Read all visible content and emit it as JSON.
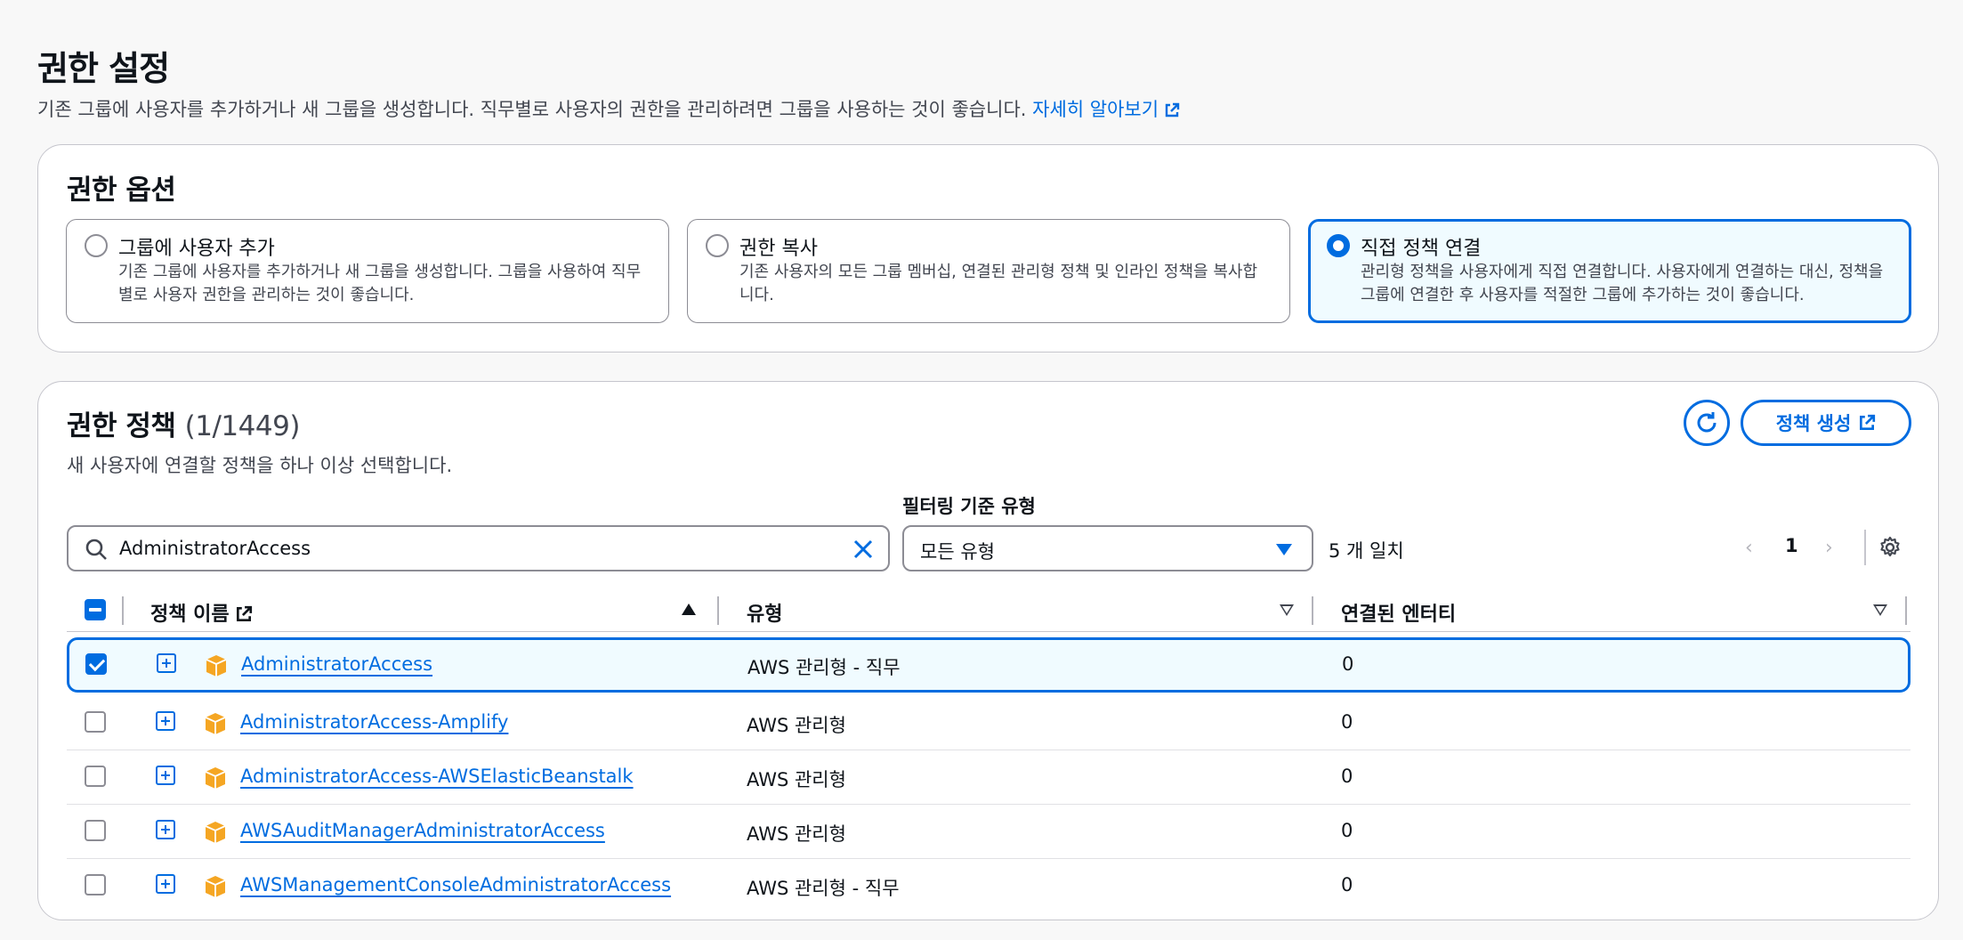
{
  "header": {
    "title": "권한 설정",
    "description": "기존 그룹에 사용자를 추가하거나 새 그룹을 생성합니다. 직무별로 사용자의 권한을 관리하려면 그룹을 사용하는 것이 좋습니다.",
    "learn_more": "자세히 알아보기"
  },
  "options": {
    "title": "권한 옵션",
    "tiles": [
      {
        "title": "그룹에 사용자 추가",
        "desc": "기존 그룹에 사용자를 추가하거나 새 그룹을 생성합니다. 그룹을 사용하여 직무별로 사용자 권한을 관리하는 것이 좋습니다.",
        "selected": false
      },
      {
        "title": "권한 복사",
        "desc": "기존 사용자의 모든 그룹 멤버십, 연결된 관리형 정책 및 인라인 정책을 복사합니다.",
        "selected": false
      },
      {
        "title": "직접 정책 연결",
        "desc": "관리형 정책을 사용자에게 직접 연결합니다. 사용자에게 연결하는 대신, 정책을 그룹에 연결한 후 사용자를 적절한 그룹에 추가하는 것이 좋습니다.",
        "selected": true
      }
    ]
  },
  "policies": {
    "title": "권한 정책",
    "count": "(1/1449)",
    "description": "새 사용자에 연결할 정책을 하나 이상 선택합니다.",
    "create_label": "정책 생성",
    "filter_label": "필터링 기준 유형",
    "search_value": "AdministratorAccess",
    "filter_value": "모든 유형",
    "match_text": "5 개 일치",
    "page": "1",
    "pager_prev": "‹",
    "pager_next": "›",
    "columns": {
      "name": "정책 이름",
      "type": "유형",
      "entities": "연결된 엔터티"
    },
    "rows": [
      {
        "name": "AdministratorAccess",
        "type": "AWS 관리형 - 직무",
        "entities": "0",
        "checked": true
      },
      {
        "name": "AdministratorAccess-Amplify",
        "type": "AWS 관리형",
        "entities": "0",
        "checked": false
      },
      {
        "name": "AdministratorAccess-AWSElasticBeanstalk",
        "type": "AWS 관리형",
        "entities": "0",
        "checked": false
      },
      {
        "name": "AWSAuditManagerAdministratorAccess",
        "type": "AWS 관리형",
        "entities": "0",
        "checked": false
      },
      {
        "name": "AWSManagementConsoleAdministratorAccess",
        "type": "AWS 관리형 - 직무",
        "entities": "0",
        "checked": false
      }
    ]
  },
  "icons": {
    "external": "external-link-icon",
    "refresh": "refresh-icon",
    "search": "search-icon",
    "clear": "close-icon",
    "settings": "gear-icon",
    "policy": "cube-icon",
    "expand": "expand-icon"
  },
  "colors": {
    "accent": "#006ce0",
    "selected_bg": "#f0fbff",
    "cube": "#f5a623"
  }
}
